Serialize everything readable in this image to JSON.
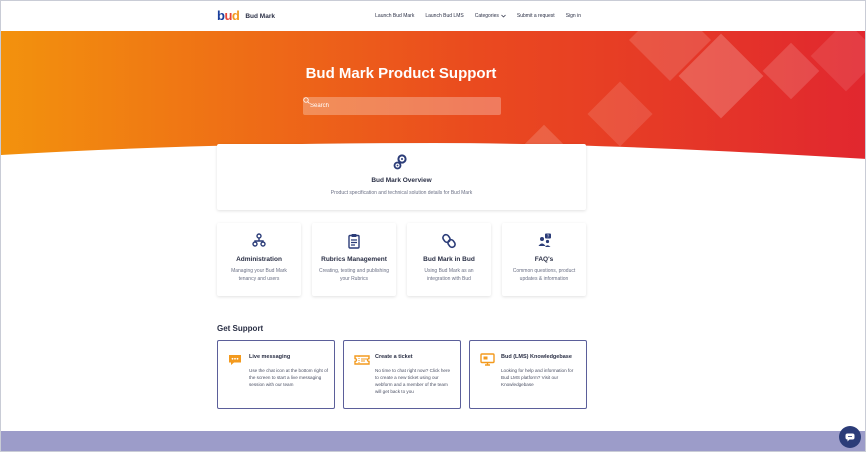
{
  "header": {
    "logo_text": "Bud Mark",
    "nav": {
      "launch_bud_mark": "Launch Bud Mark",
      "launch_bud_lms": "Launch Bud LMS",
      "categories": "Categories",
      "submit_request": "Submit a request",
      "sign_in": "Sign in"
    }
  },
  "hero": {
    "title": "Bud Mark Product Support",
    "search_placeholder": "Search"
  },
  "overview": {
    "title": "Bud Mark Overview",
    "description": "Product specification and technical solution details for Bud Mark"
  },
  "categories": [
    {
      "title": "Administration",
      "description": "Managing your Bud Mark tenancy and users",
      "icon": "org-chart-icon"
    },
    {
      "title": "Rubrics Management",
      "description": "Creating, testing and publishing your Rubrics",
      "icon": "clipboard-icon"
    },
    {
      "title": "Bud Mark in Bud",
      "description": "Using Bud Mark as an integration with Bud",
      "icon": "link-icon"
    },
    {
      "title": "FAQ's",
      "description": "Common questions, product updates & information",
      "icon": "question-people-icon"
    }
  ],
  "get_support": {
    "title": "Get Support",
    "cards": [
      {
        "title": "Live messaging",
        "description": "Use the chat icon at the bottom right of the screen to start a live messaging session with our team",
        "icon": "chat-icon"
      },
      {
        "title": "Create a ticket",
        "description": "No time to chat right now? Click here to create a new ticket using our webform and a member of the team will get back to you",
        "icon": "ticket-icon"
      },
      {
        "title": "Bud (LMS) Knowledgebase",
        "description": "Looking for help and information for Bud LMS platform? Visit our Knowledgebase",
        "icon": "monitor-icon"
      }
    ]
  },
  "colors": {
    "brand_navy": "#2b3c78",
    "hero_orange": "#f3920d",
    "hero_red": "#e1272f",
    "accent_orange": "#f39a1e",
    "footer": "#9c9cc9"
  }
}
